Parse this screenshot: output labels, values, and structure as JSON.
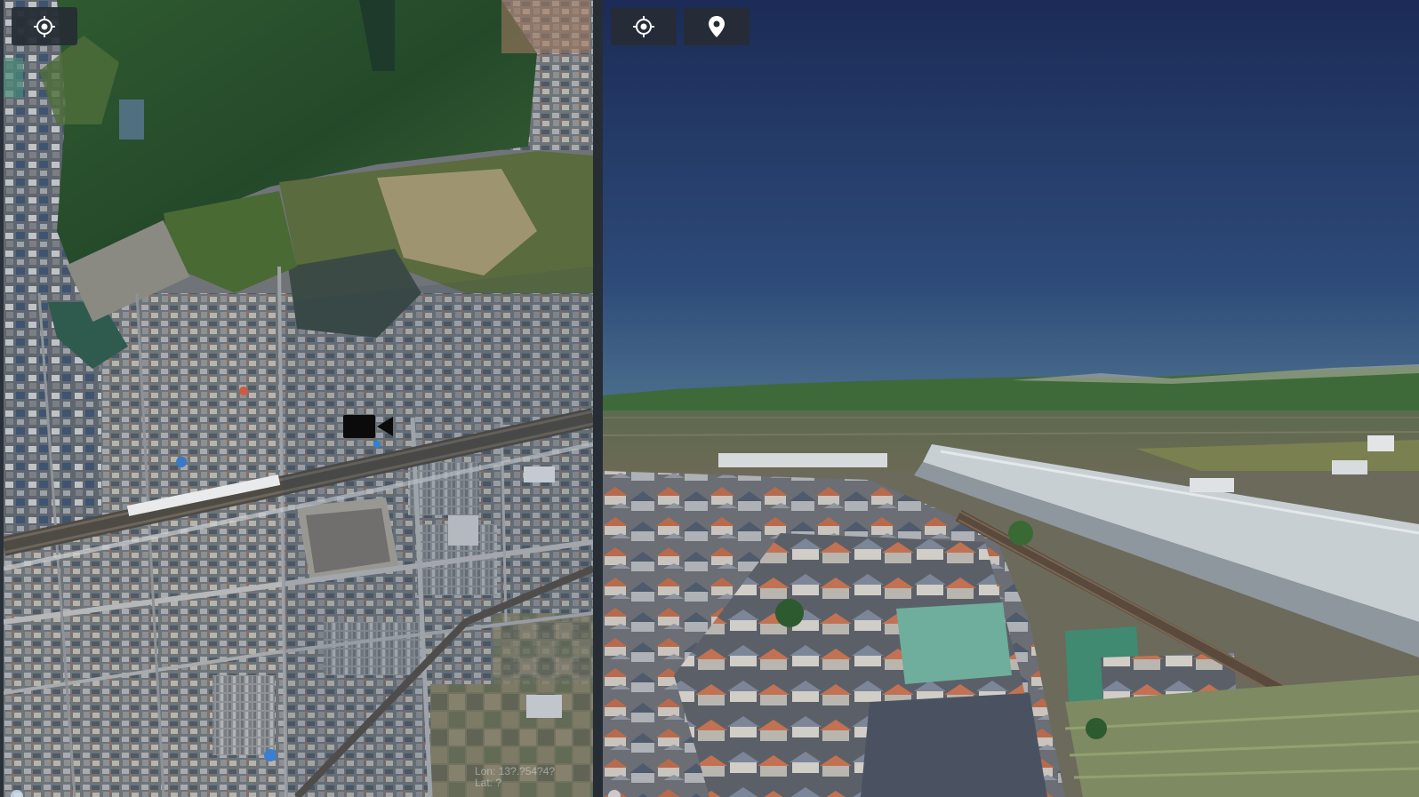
{
  "left_panel": {
    "view": "2D aerial map",
    "locate_button_icon": "crosshair-locate-icon",
    "camera_marker_icon": "video-camera-icon",
    "coordinates": {
      "lon_text": "Lon: 13?.?54?4?",
      "lat_text": "Lat: ?"
    }
  },
  "right_panel": {
    "view": "3D perspective scene",
    "locate_button_icon": "crosshair-locate-icon",
    "pin_button_icon": "map-pin-icon"
  },
  "colors": {
    "toolbar_button_bg": "#262c34",
    "icon_color": "#ffffff",
    "panel_divider": "#262d34",
    "sky_top": "#1c2b57",
    "sky_horizon": "#46688a"
  }
}
